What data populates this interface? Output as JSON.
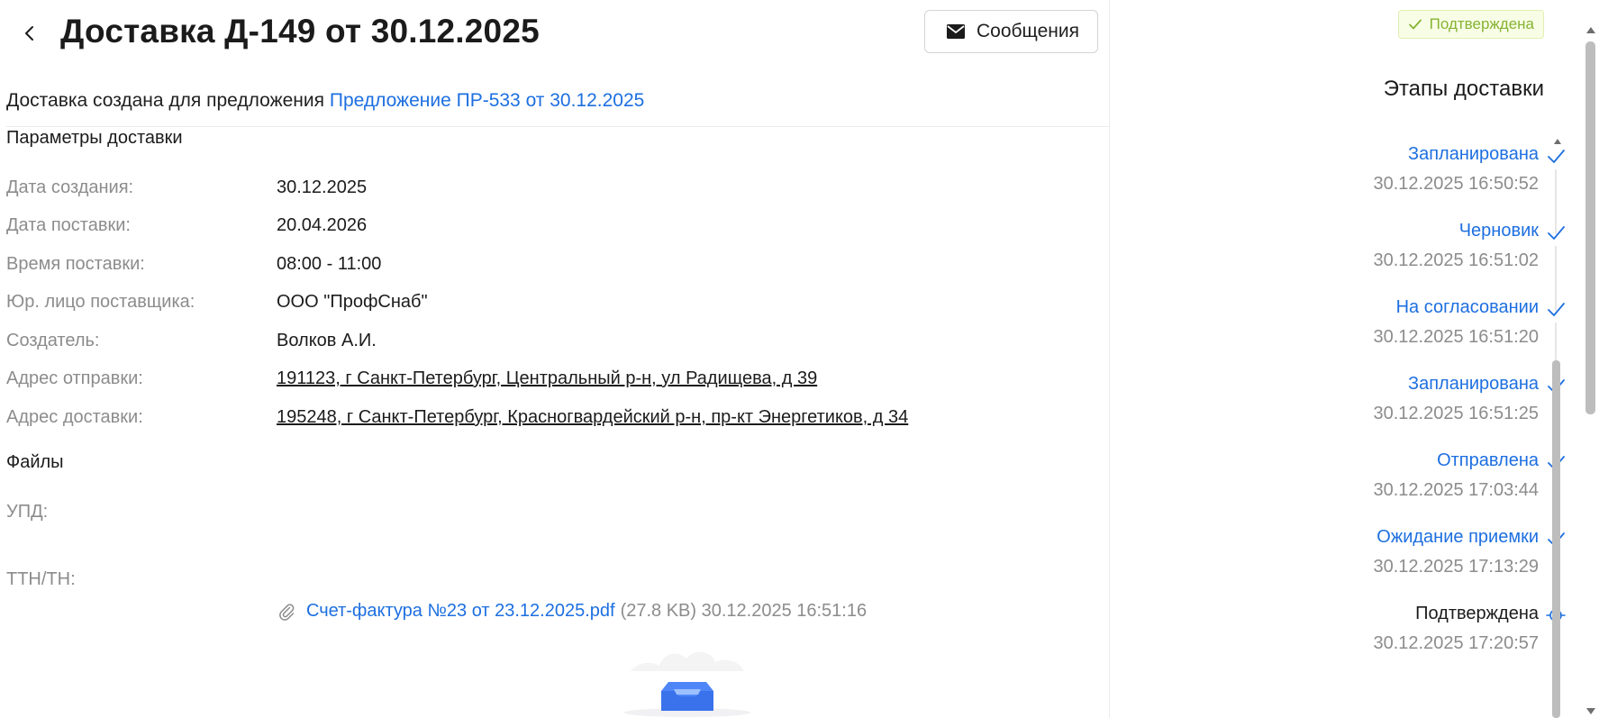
{
  "header": {
    "title": "Доставка Д-149 от 30.12.2025",
    "messages_label": "Сообщения"
  },
  "created_for": {
    "prefix": "Доставка создана для предложения",
    "link": "Предложение ПР-533 от 30.12.2025"
  },
  "params": {
    "title": "Параметры доставки",
    "fields": [
      {
        "label": "Дата создания:",
        "value": "30.12.2025"
      },
      {
        "label": "Дата поставки:",
        "value": "20.04.2026"
      },
      {
        "label": "Время поставки:",
        "value": "08:00 - 11:00"
      },
      {
        "label": "Юр. лицо поставщика:",
        "value": "ООО \"ПрофСнаб\""
      },
      {
        "label": "Создатель:",
        "value": "Волков А.И."
      },
      {
        "label": "Адрес отправки:",
        "value": "191123, г Санкт-Петербург, Центральный р-н, ул Радищева, д 39"
      },
      {
        "label": "Адрес доставки:",
        "value": "195248, г Санкт-Петербург, Красногвардейский р-н, пр-кт Энергетиков, д 34"
      }
    ]
  },
  "files": {
    "title": "Файлы",
    "upd_label": "УПД:",
    "upd_file": {
      "name": "Счет-фактура №23 от 23.12.2025.pdf",
      "meta": "(27.8 KB) 30.12.2025 16:51:16"
    },
    "ttn_label": "ТТН/ТН:"
  },
  "status_badge": "Подтверждена",
  "stages": {
    "title": "Этапы доставки",
    "items": [
      {
        "name": "Запланирована",
        "time": "30.12.2025 16:50:52",
        "state": "done"
      },
      {
        "name": "Черновик",
        "time": "30.12.2025 16:51:02",
        "state": "done"
      },
      {
        "name": "На согласовании",
        "time": "30.12.2025 16:51:20",
        "state": "done"
      },
      {
        "name": "Запланирована",
        "time": "30.12.2025 16:51:25",
        "state": "done"
      },
      {
        "name": "Отправлена",
        "time": "30.12.2025 17:03:44",
        "state": "done"
      },
      {
        "name": "Ожидание приемки",
        "time": "30.12.2025 17:13:29",
        "state": "done"
      },
      {
        "name": "Подтверждена",
        "time": "30.12.2025 17:20:57",
        "state": "current"
      }
    ]
  },
  "colors": {
    "link": "#1d6fe0",
    "label": "#8c8c8c",
    "badge_bg": "#f8fde6",
    "badge_text": "#86b332"
  },
  "icons": [
    "back-arrow-icon",
    "mail-icon",
    "paperclip-icon",
    "check-icon",
    "current-stage-icon",
    "empty-inbox-icon"
  ]
}
